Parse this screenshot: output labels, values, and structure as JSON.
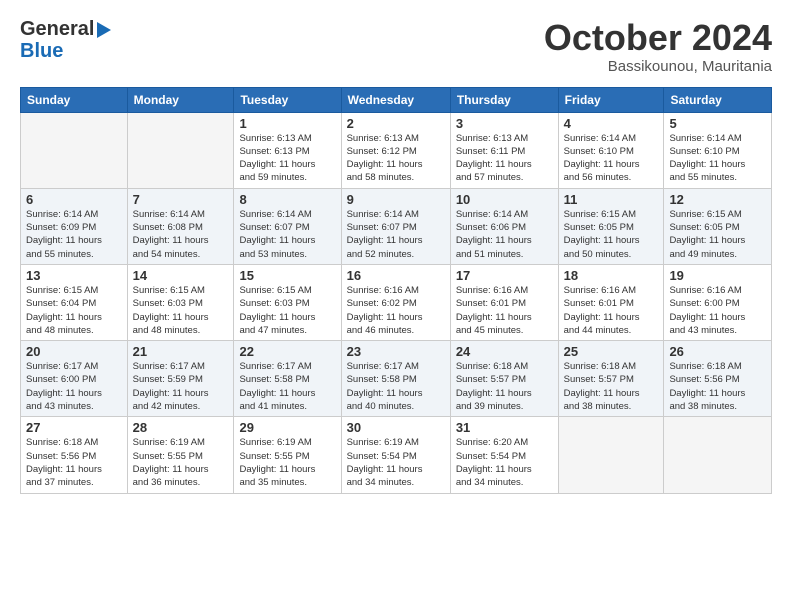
{
  "header": {
    "logo_line1": "General",
    "logo_line2": "Blue",
    "month_title": "October 2024",
    "subtitle": "Bassikounou, Mauritania"
  },
  "weekdays": [
    "Sunday",
    "Monday",
    "Tuesday",
    "Wednesday",
    "Thursday",
    "Friday",
    "Saturday"
  ],
  "weeks": [
    [
      {
        "day": "",
        "empty": true
      },
      {
        "day": "",
        "empty": true
      },
      {
        "day": "1",
        "line1": "Sunrise: 6:13 AM",
        "line2": "Sunset: 6:13 PM",
        "line3": "Daylight: 11 hours",
        "line4": "and 59 minutes."
      },
      {
        "day": "2",
        "line1": "Sunrise: 6:13 AM",
        "line2": "Sunset: 6:12 PM",
        "line3": "Daylight: 11 hours",
        "line4": "and 58 minutes."
      },
      {
        "day": "3",
        "line1": "Sunrise: 6:13 AM",
        "line2": "Sunset: 6:11 PM",
        "line3": "Daylight: 11 hours",
        "line4": "and 57 minutes."
      },
      {
        "day": "4",
        "line1": "Sunrise: 6:14 AM",
        "line2": "Sunset: 6:10 PM",
        "line3": "Daylight: 11 hours",
        "line4": "and 56 minutes."
      },
      {
        "day": "5",
        "line1": "Sunrise: 6:14 AM",
        "line2": "Sunset: 6:10 PM",
        "line3": "Daylight: 11 hours",
        "line4": "and 55 minutes."
      }
    ],
    [
      {
        "day": "6",
        "line1": "Sunrise: 6:14 AM",
        "line2": "Sunset: 6:09 PM",
        "line3": "Daylight: 11 hours",
        "line4": "and 55 minutes."
      },
      {
        "day": "7",
        "line1": "Sunrise: 6:14 AM",
        "line2": "Sunset: 6:08 PM",
        "line3": "Daylight: 11 hours",
        "line4": "and 54 minutes."
      },
      {
        "day": "8",
        "line1": "Sunrise: 6:14 AM",
        "line2": "Sunset: 6:07 PM",
        "line3": "Daylight: 11 hours",
        "line4": "and 53 minutes."
      },
      {
        "day": "9",
        "line1": "Sunrise: 6:14 AM",
        "line2": "Sunset: 6:07 PM",
        "line3": "Daylight: 11 hours",
        "line4": "and 52 minutes."
      },
      {
        "day": "10",
        "line1": "Sunrise: 6:14 AM",
        "line2": "Sunset: 6:06 PM",
        "line3": "Daylight: 11 hours",
        "line4": "and 51 minutes."
      },
      {
        "day": "11",
        "line1": "Sunrise: 6:15 AM",
        "line2": "Sunset: 6:05 PM",
        "line3": "Daylight: 11 hours",
        "line4": "and 50 minutes."
      },
      {
        "day": "12",
        "line1": "Sunrise: 6:15 AM",
        "line2": "Sunset: 6:05 PM",
        "line3": "Daylight: 11 hours",
        "line4": "and 49 minutes."
      }
    ],
    [
      {
        "day": "13",
        "line1": "Sunrise: 6:15 AM",
        "line2": "Sunset: 6:04 PM",
        "line3": "Daylight: 11 hours",
        "line4": "and 48 minutes."
      },
      {
        "day": "14",
        "line1": "Sunrise: 6:15 AM",
        "line2": "Sunset: 6:03 PM",
        "line3": "Daylight: 11 hours",
        "line4": "and 48 minutes."
      },
      {
        "day": "15",
        "line1": "Sunrise: 6:15 AM",
        "line2": "Sunset: 6:03 PM",
        "line3": "Daylight: 11 hours",
        "line4": "and 47 minutes."
      },
      {
        "day": "16",
        "line1": "Sunrise: 6:16 AM",
        "line2": "Sunset: 6:02 PM",
        "line3": "Daylight: 11 hours",
        "line4": "and 46 minutes."
      },
      {
        "day": "17",
        "line1": "Sunrise: 6:16 AM",
        "line2": "Sunset: 6:01 PM",
        "line3": "Daylight: 11 hours",
        "line4": "and 45 minutes."
      },
      {
        "day": "18",
        "line1": "Sunrise: 6:16 AM",
        "line2": "Sunset: 6:01 PM",
        "line3": "Daylight: 11 hours",
        "line4": "and 44 minutes."
      },
      {
        "day": "19",
        "line1": "Sunrise: 6:16 AM",
        "line2": "Sunset: 6:00 PM",
        "line3": "Daylight: 11 hours",
        "line4": "and 43 minutes."
      }
    ],
    [
      {
        "day": "20",
        "line1": "Sunrise: 6:17 AM",
        "line2": "Sunset: 6:00 PM",
        "line3": "Daylight: 11 hours",
        "line4": "and 43 minutes."
      },
      {
        "day": "21",
        "line1": "Sunrise: 6:17 AM",
        "line2": "Sunset: 5:59 PM",
        "line3": "Daylight: 11 hours",
        "line4": "and 42 minutes."
      },
      {
        "day": "22",
        "line1": "Sunrise: 6:17 AM",
        "line2": "Sunset: 5:58 PM",
        "line3": "Daylight: 11 hours",
        "line4": "and 41 minutes."
      },
      {
        "day": "23",
        "line1": "Sunrise: 6:17 AM",
        "line2": "Sunset: 5:58 PM",
        "line3": "Daylight: 11 hours",
        "line4": "and 40 minutes."
      },
      {
        "day": "24",
        "line1": "Sunrise: 6:18 AM",
        "line2": "Sunset: 5:57 PM",
        "line3": "Daylight: 11 hours",
        "line4": "and 39 minutes."
      },
      {
        "day": "25",
        "line1": "Sunrise: 6:18 AM",
        "line2": "Sunset: 5:57 PM",
        "line3": "Daylight: 11 hours",
        "line4": "and 38 minutes."
      },
      {
        "day": "26",
        "line1": "Sunrise: 6:18 AM",
        "line2": "Sunset: 5:56 PM",
        "line3": "Daylight: 11 hours",
        "line4": "and 38 minutes."
      }
    ],
    [
      {
        "day": "27",
        "line1": "Sunrise: 6:18 AM",
        "line2": "Sunset: 5:56 PM",
        "line3": "Daylight: 11 hours",
        "line4": "and 37 minutes."
      },
      {
        "day": "28",
        "line1": "Sunrise: 6:19 AM",
        "line2": "Sunset: 5:55 PM",
        "line3": "Daylight: 11 hours",
        "line4": "and 36 minutes."
      },
      {
        "day": "29",
        "line1": "Sunrise: 6:19 AM",
        "line2": "Sunset: 5:55 PM",
        "line3": "Daylight: 11 hours",
        "line4": "and 35 minutes."
      },
      {
        "day": "30",
        "line1": "Sunrise: 6:19 AM",
        "line2": "Sunset: 5:54 PM",
        "line3": "Daylight: 11 hours",
        "line4": "and 34 minutes."
      },
      {
        "day": "31",
        "line1": "Sunrise: 6:20 AM",
        "line2": "Sunset: 5:54 PM",
        "line3": "Daylight: 11 hours",
        "line4": "and 34 minutes."
      },
      {
        "day": "",
        "empty": true
      },
      {
        "day": "",
        "empty": true
      }
    ]
  ]
}
